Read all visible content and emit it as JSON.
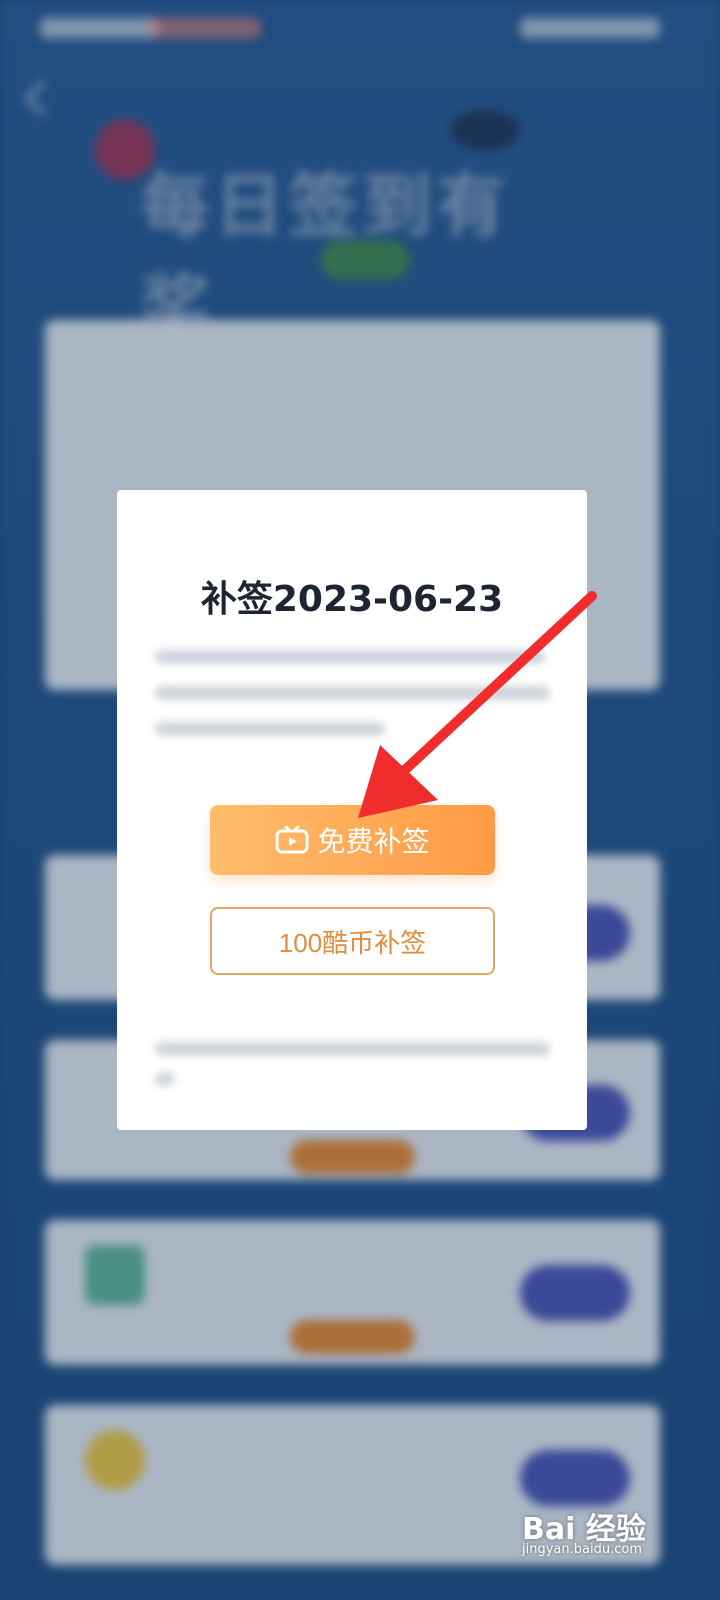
{
  "modal": {
    "title": "补签2023-06-23",
    "free_button": "免费补签",
    "coin_button": "100酷币补签"
  },
  "background": {
    "hero_title": "每日签到有奖"
  },
  "watermark": {
    "brand": "Bai 经验",
    "site": "jingyan.baidu.com"
  },
  "colors": {
    "accent_orange": "#ff9a45",
    "outline_orange": "#e7a65f",
    "arrow_red": "#f02c2c",
    "background_blue": "#24578f"
  }
}
